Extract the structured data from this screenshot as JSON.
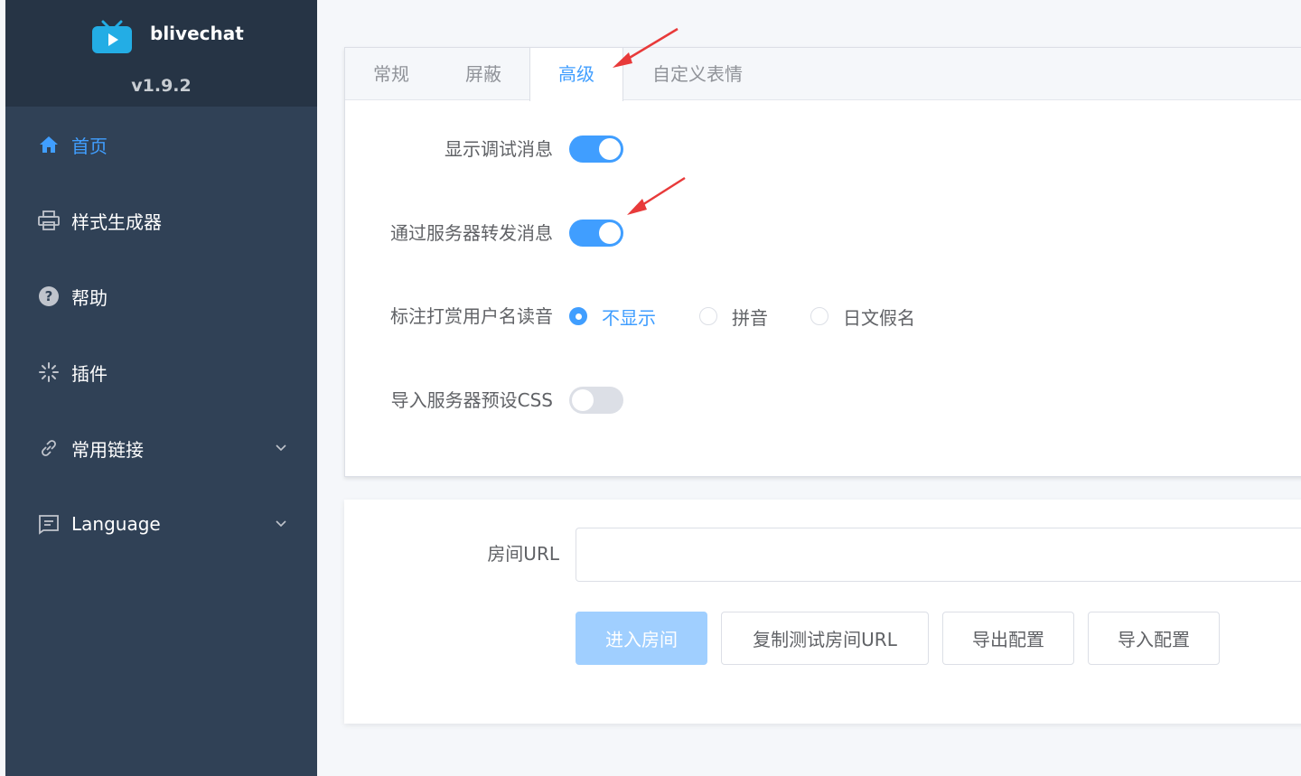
{
  "sidebar": {
    "app_name": "blivechat",
    "version": "v1.9.2",
    "items": [
      {
        "label": "首页",
        "icon": "home-icon",
        "active": true
      },
      {
        "label": "样式生成器",
        "icon": "printer-icon"
      },
      {
        "label": "帮助",
        "icon": "question-icon"
      },
      {
        "label": "插件",
        "icon": "loading-icon"
      },
      {
        "label": "常用链接",
        "icon": "link-icon",
        "expandable": true
      },
      {
        "label": "Language",
        "icon": "message-icon",
        "expandable": true
      }
    ]
  },
  "tabs": [
    {
      "label": "常规"
    },
    {
      "label": "屏蔽"
    },
    {
      "label": "高级",
      "active": true
    },
    {
      "label": "自定义表情"
    }
  ],
  "advanced": {
    "show_debug_label": "显示调试消息",
    "show_debug_on": true,
    "relay_label": "通过服务器转发消息",
    "relay_on": true,
    "reading_label": "标注打赏用户名读音",
    "reading_options": [
      "不显示",
      "拼音",
      "日文假名"
    ],
    "reading_selected": "不显示",
    "import_css_label": "导入服务器预设CSS",
    "import_css_on": false
  },
  "room": {
    "url_label": "房间URL",
    "url_value": "",
    "enter_button": "进入房间",
    "copy_test_button": "复制测试房间URL",
    "export_button": "导出配置",
    "import_button": "导入配置"
  },
  "colors": {
    "accent": "#409eff",
    "sidebar_bg": "#304156",
    "annotation_arrow": "#e83a3a"
  }
}
